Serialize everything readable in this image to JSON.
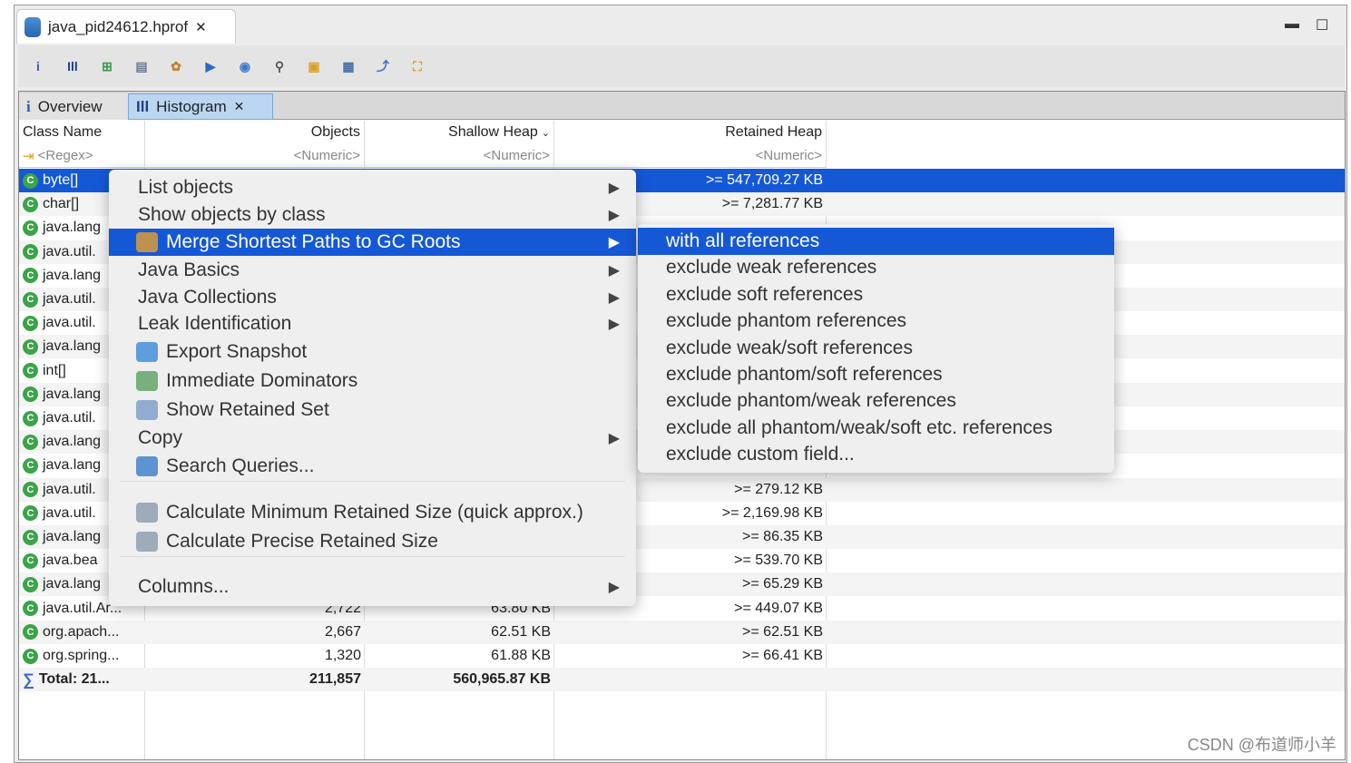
{
  "editor_tab": {
    "title": "java_pid24612.hprof"
  },
  "toolbar": {
    "icons": [
      "info-icon",
      "histogram-icon",
      "dominator-tree-icon",
      "oql-icon",
      "heap-dump-overview-icon",
      "run-report-icon",
      "query-browser-icon",
      "search-icon",
      "group-icon",
      "calculate-icon",
      "export-icon",
      "compare-icon"
    ]
  },
  "tabs": [
    {
      "label": "Overview"
    },
    {
      "label": "Histogram"
    }
  ],
  "columns": [
    "Class Name",
    "Objects",
    "Shallow Heap",
    "Retained Heap"
  ],
  "filters": [
    "<Regex>",
    "<Numeric>",
    "<Numeric>",
    "<Numeric>"
  ],
  "rows": [
    {
      "name": "byte[]",
      "objects": "",
      "shallow": "",
      "retained": ">= 547,709.27 KB"
    },
    {
      "name": "char[]",
      "objects": "",
      "shallow": "",
      "retained": ">= 7,281.77 KB"
    },
    {
      "name": "java.lang",
      "objects": "",
      "shallow": "",
      "retained": ""
    },
    {
      "name": "java.util.",
      "objects": "",
      "shallow": "",
      "retained": ""
    },
    {
      "name": "java.lang",
      "objects": "",
      "shallow": "",
      "retained": ""
    },
    {
      "name": "java.util.",
      "objects": "",
      "shallow": "",
      "retained": ""
    },
    {
      "name": "java.util.",
      "objects": "",
      "shallow": "",
      "retained": ""
    },
    {
      "name": "java.lang",
      "objects": "",
      "shallow": "",
      "retained": ""
    },
    {
      "name": "int[]",
      "objects": "",
      "shallow": "",
      "retained": ""
    },
    {
      "name": "java.lang",
      "objects": "",
      "shallow": "",
      "retained": ""
    },
    {
      "name": "java.util.",
      "objects": "",
      "shallow": "",
      "retained": ""
    },
    {
      "name": "java.lang",
      "objects": "",
      "shallow": "",
      "retained": ""
    },
    {
      "name": "java.lang",
      "objects": "",
      "shallow": "",
      "retained": ""
    },
    {
      "name": "java.util.",
      "objects": "",
      "shallow": "",
      "retained": ">= 279.12 KB"
    },
    {
      "name": "java.util.",
      "objects": "",
      "shallow": "",
      "retained": ">= 2,169.98 KB"
    },
    {
      "name": "java.lang",
      "objects": "",
      "shallow": "",
      "retained": ">= 86.35 KB"
    },
    {
      "name": "java.bea",
      "objects": "",
      "shallow": "",
      "retained": ">= 539.70 KB"
    },
    {
      "name": "java.lang",
      "objects": "",
      "shallow": "",
      "retained": ">= 65.29 KB"
    },
    {
      "name": "java.util.Ar...",
      "objects": "2,722",
      "shallow": "63.80 KB",
      "retained": ">= 449.07 KB"
    },
    {
      "name": "org.apach...",
      "objects": "2,667",
      "shallow": "62.51 KB",
      "retained": ">= 62.51 KB"
    },
    {
      "name": "org.spring...",
      "objects": "1,320",
      "shallow": "61.88 KB",
      "retained": ">= 66.41 KB"
    }
  ],
  "total": {
    "name": "Total: 21...",
    "objects": "211,857",
    "shallow": "560,965.87 KB"
  },
  "context_menu": [
    {
      "label": "List objects",
      "submenu": true
    },
    {
      "label": "Show objects by class",
      "submenu": true
    },
    {
      "label": "Merge Shortest Paths to GC Roots",
      "submenu": true,
      "icon": "merge-paths-icon",
      "highlighted": true
    },
    {
      "label": "Java Basics",
      "submenu": true
    },
    {
      "label": "Java Collections",
      "submenu": true
    },
    {
      "label": "Leak Identification",
      "submenu": true
    },
    {
      "label": "Export Snapshot",
      "icon": "export-snapshot-icon"
    },
    {
      "label": "Immediate Dominators",
      "icon": "dominators-icon"
    },
    {
      "label": "Show Retained Set",
      "icon": "retained-set-icon"
    },
    {
      "label": "Copy",
      "submenu": true
    },
    {
      "label": "Search Queries...",
      "icon": "search-queries-icon"
    },
    {
      "label": "Calculate Minimum Retained Size (quick approx.)",
      "icon": "calculator-icon"
    },
    {
      "label": "Calculate Precise Retained Size",
      "icon": "calculator-icon"
    },
    {
      "label": "Columns...",
      "submenu": true
    }
  ],
  "submenu": [
    "with all references",
    "exclude weak references",
    "exclude soft references",
    "exclude phantom references",
    "exclude weak/soft references",
    "exclude phantom/soft references",
    "exclude phantom/weak references",
    "exclude all phantom/weak/soft etc. references",
    "exclude custom field..."
  ],
  "watermark": "CSDN @布道师小羊",
  "colors": {
    "selection": "#1558d6",
    "class_icon": "#3aa447"
  }
}
